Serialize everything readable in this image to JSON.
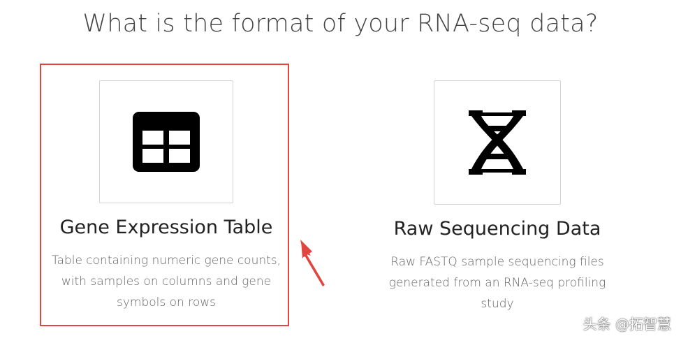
{
  "page": {
    "title": "What is the format of your RNA-seq data?"
  },
  "options": [
    {
      "key": "gene-expression-table",
      "title": "Gene Expression Table",
      "description": "Table containing numeric gene counts, with samples on columns and gene symbols on rows",
      "icon": "table-icon",
      "highlighted": true
    },
    {
      "key": "raw-sequencing-data",
      "title": "Raw Sequencing Data",
      "description": "Raw FASTQ sample sequencing files generated from an RNA-seq profiling study",
      "icon": "dna-icon",
      "highlighted": false
    }
  ],
  "annotation": {
    "highlight_color": "#e0463f",
    "arrow_color": "#e0463f"
  },
  "watermark": {
    "text": "头条 @拓智慧"
  }
}
